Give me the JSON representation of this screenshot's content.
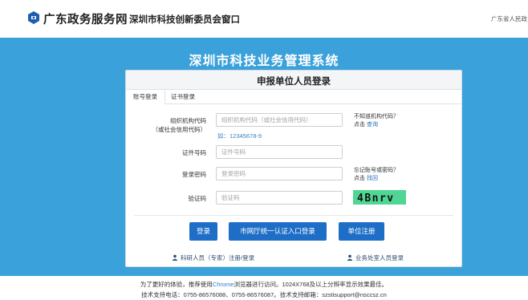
{
  "header": {
    "brand": "广东政务服务网",
    "window_title": "深圳市科技创新委员会窗口",
    "region": "广东省人民政"
  },
  "system_title": "深圳市科技业务管理系统",
  "login": {
    "title": "申报单位人员登录",
    "tabs": [
      "账号登录",
      "证书登录"
    ],
    "fields": {
      "org_code_label_1": "组织机构代码",
      "org_code_label_2": "（或社会信用代码）",
      "org_code_placeholder": "组织机构代码（或社会信用代码）",
      "org_code_hint": "如：12345678-9",
      "cert_label": "证件号码",
      "cert_placeholder": "证件号码",
      "password_label": "登录密码",
      "password_placeholder": "登录密码",
      "captcha_label": "验证码",
      "captcha_placeholder": "验证码",
      "captcha_text": "4Bnrv"
    },
    "help": {
      "org_question": "不知道机构代码？",
      "click": "点击",
      "query": "查询",
      "pwd_question": "忘记账号或密码？",
      "retrieve": "找回"
    },
    "buttons": {
      "login": "登录",
      "unified_login": "市网厅统一认证入口登录",
      "register": "单位注册"
    },
    "links": {
      "expert": "科研人员（专家）注册/登录",
      "staff": "业务处室人员登录"
    }
  },
  "footer": {
    "line1_prefix": "为了更好的体验，推荐使用",
    "browser": "Chrome",
    "line1_suffix": "浏览器进行访问。1024X768及以上分辨率显示效果最佳。",
    "line2": "技术支持电话：0755-86576088、0755-86576087。技术支持邮箱：szstisupport@nsccsz.cn"
  },
  "colors": {
    "background_blue": "#3ba1da",
    "button_blue": "#1e6ec8",
    "captcha_green": "#4fd694"
  }
}
